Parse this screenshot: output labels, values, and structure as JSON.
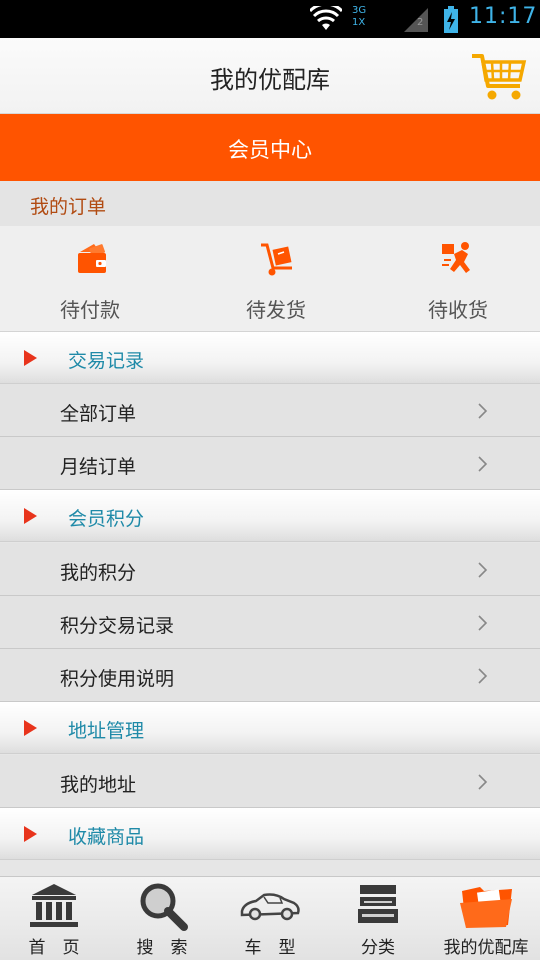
{
  "status_bar": {
    "net_top": "3G",
    "net_bottom": "1X",
    "sim_index": "2",
    "time": "11:17"
  },
  "header": {
    "title": "我的优配库",
    "cart_icon": "shopping-cart-icon"
  },
  "member_center": {
    "title": "会员中心"
  },
  "orders": {
    "title": "我的订单",
    "items": [
      {
        "label": "待付款",
        "icon": "wallet-icon"
      },
      {
        "label": "待发货",
        "icon": "hand-truck-icon"
      },
      {
        "label": "待收货",
        "icon": "delivery-runner-icon"
      }
    ]
  },
  "sections": [
    {
      "label": "交易记录",
      "rows": [
        {
          "label": "全部订单"
        },
        {
          "label": "月结订单"
        }
      ]
    },
    {
      "label": "会员积分",
      "rows": [
        {
          "label": "我的积分"
        },
        {
          "label": "积分交易记录"
        },
        {
          "label": "积分使用说明"
        }
      ]
    },
    {
      "label": "地址管理",
      "rows": [
        {
          "label": "我的地址"
        }
      ]
    },
    {
      "label": "收藏商品",
      "rows": []
    }
  ],
  "tabbar": {
    "items": [
      {
        "label": "首　页",
        "icon": "bank-building-icon"
      },
      {
        "label": "搜　索",
        "icon": "magnifier-icon"
      },
      {
        "label": "车　型",
        "icon": "car-icon"
      },
      {
        "label": "分类",
        "icon": "stack-icon"
      },
      {
        "label": "我的优配库",
        "icon": "folder-icon",
        "active": true
      }
    ]
  },
  "colors": {
    "accent": "#ff5400",
    "section_text": "#1f8aa8",
    "section_arrow": "#e8341c",
    "orders_title": "#b14b12"
  }
}
